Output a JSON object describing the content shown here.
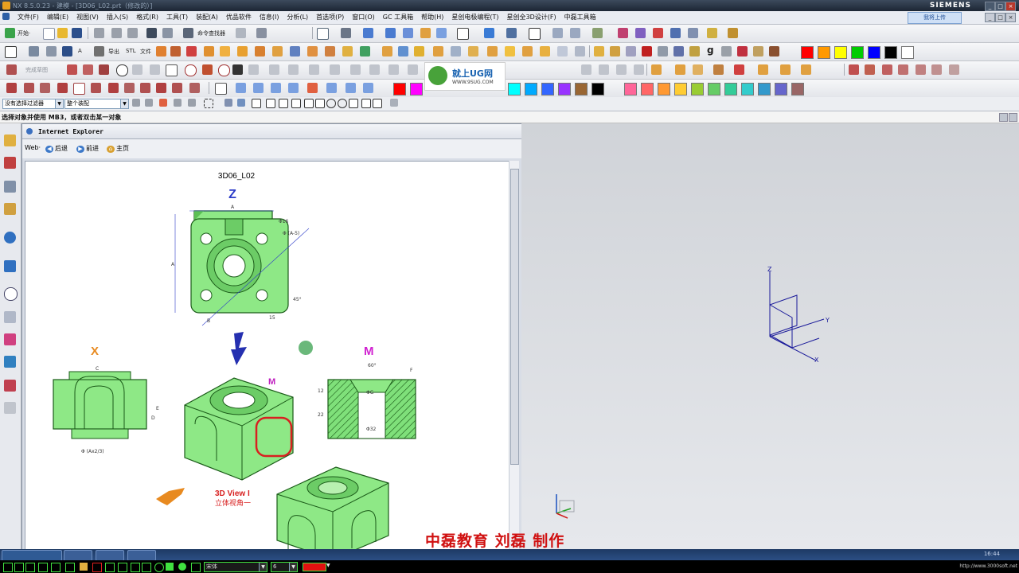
{
  "window": {
    "title": "NX 8.5.0.23 - 建模 - [3D06_L02.prt（修改的）]",
    "brand": "SIEMENS",
    "share_button": "我将上传"
  },
  "menu": [
    "文件(F)",
    "编辑(E)",
    "视图(V)",
    "插入(S)",
    "格式(R)",
    "工具(T)",
    "装配(A)",
    "优品软件",
    "信息(I)",
    "分析(L)",
    "首选项(P)",
    "窗口(O)",
    "GC 工具箱",
    "帮助(H)",
    "星创电极编程(T)",
    "星创全3D设计(F)",
    "中磊工具箱"
  ],
  "toolbar": {
    "start_label": "开始·",
    "command_finder": "命令查找器",
    "export_label": "导出",
    "stl_label": "STL",
    "file_label": "文件",
    "sketch_label": "完成草图",
    "logo_text": "就上UG网",
    "logo_url": "WWW.9SUG.COM"
  },
  "colors_row2": [
    "#ff0000",
    "#ff9900",
    "#ffff00",
    "#00cc00",
    "#0000ff",
    "#000000",
    "#ffffff"
  ],
  "colors_row3": [
    "#ff0000",
    "#ff00ff",
    "#00ffff",
    "#00aaff",
    "#3366ff",
    "#9933ff",
    "#996633",
    "#000000",
    "#ff6699",
    "#ff6666",
    "#ff9933",
    "#ffcc33",
    "#99cc33",
    "#66cc66",
    "#33cc99",
    "#33cccc",
    "#3399cc",
    "#6666cc",
    "#996666"
  ],
  "filterbar": {
    "filter_value": "没有选择过滤器",
    "assembly_value": "整个装配"
  },
  "cue": "选择对象并使用 MB3，或者双击某一对象",
  "ie": {
    "title": "Internet Explorer",
    "web_label": "Web·",
    "back_label": "后退",
    "forward_label": "前进",
    "home_label": "主页"
  },
  "drawing": {
    "title": "3D06_L02",
    "view_z": "Z",
    "view_x": "X",
    "view_m": "M",
    "view3d_label": "3D View I",
    "view3d_sub": "立体视角一",
    "dim_a": "A",
    "dim_b": "B",
    "dim_c": "C",
    "dim_d": "D",
    "dim_e": "E",
    "dim_f": "F",
    "dim_15": "15",
    "dim_45": "45°",
    "dim_60": "60°",
    "dim_phi16": "Φ16",
    "dim_phi_a5": "Φ (A-5)",
    "dim_phi_ax": "Φ (Ax2/3)",
    "dim_phi_g": "ΦG",
    "dim_phi32": "Φ32",
    "dim_12": "12",
    "dim_22": "22"
  },
  "credit": "中磊教育  刘磊  制作",
  "statusbar": {
    "font_combo": "宋体",
    "size_combo": "6",
    "url_text": "http://www.3000soft.net",
    "clock": "16:44"
  },
  "triad": {
    "x": "X",
    "y": "Y",
    "z": "Z"
  }
}
